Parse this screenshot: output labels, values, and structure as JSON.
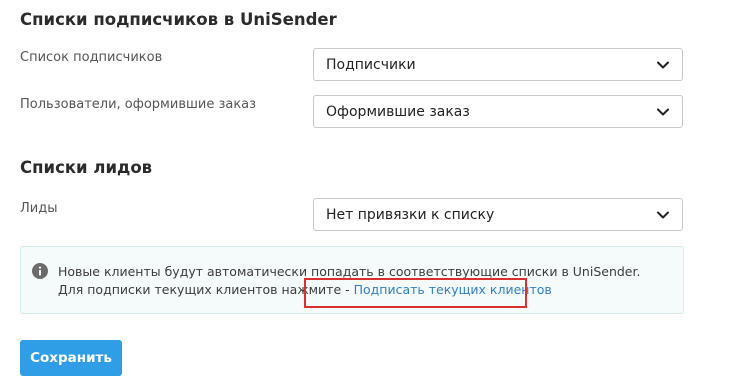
{
  "subscribers_section": {
    "title": "Списки подписчиков в UniSender",
    "fields": [
      {
        "label": "Список подписчиков",
        "value": "Подписчики",
        "icon": "chevron-down-icon"
      },
      {
        "label": "Пользователи, оформившие заказ",
        "value": "Оформившие заказ",
        "icon": "chevron-down-icon"
      }
    ]
  },
  "leads_section": {
    "title": "Списки лидов",
    "fields": [
      {
        "label": "Лиды",
        "value": "Нет привязки к списку",
        "icon": "chevron-down-icon"
      }
    ]
  },
  "info": {
    "icon": "info-icon",
    "text": "Новые клиенты будут автоматически попадать в соответствующие списки в UniSender. Для подписки текущих клиентов нажмите - ",
    "link_text": "Подписать текущих клиентов"
  },
  "actions": {
    "save_label": "Сохранить"
  },
  "colors": {
    "accent": "#2f9ee6",
    "link": "#2f80c0",
    "highlight": "#d9302f",
    "info_bg": "#f5fafa"
  }
}
